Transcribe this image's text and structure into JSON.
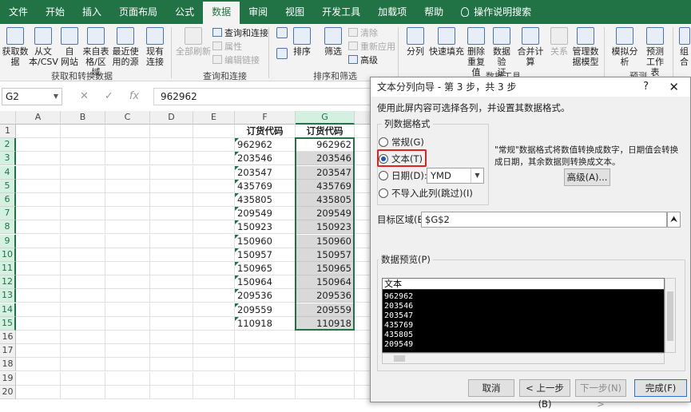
{
  "tabs": [
    "文件",
    "开始",
    "插入",
    "页面布局",
    "公式",
    "数据",
    "审阅",
    "视图",
    "开发工具",
    "加载项",
    "帮助",
    "操作说明搜索"
  ],
  "ribbon": {
    "get_data": "获取数\n据",
    "from_csv": "从文\n本/CSV",
    "from_web": "自\n网站",
    "from_table": "来自表\n格/区域",
    "recent_sources": "最近使\n用的源",
    "existing_conn": "现有\n连接",
    "group_get": "获取和转换数据",
    "refresh_all": "全部刷新",
    "queries_conn": "查询和连接",
    "properties": "属性",
    "edit_links": "编辑链接",
    "group_queries": "查询和连接",
    "sort": "排序",
    "filter": "筛选",
    "clear": "清除",
    "reapply": "重新应用",
    "advanced": "高级",
    "group_sort": "排序和筛选",
    "text_to_cols": "分列",
    "flash_fill": "快速填充",
    "remove_dup": "删除\n重复值",
    "validation": "数据验\n证",
    "consolidate": "合并计算",
    "relationships": "关系",
    "manage_model": "管理数\n据模型",
    "group_tools": "数据工具",
    "whatif": "模拟分析",
    "forecast": "预测\n工作表",
    "group_forecast": "预测",
    "outline": "组合"
  },
  "formula_bar": {
    "name_box": "G2",
    "value": "962962"
  },
  "sheet": {
    "columns": [
      "A",
      "B",
      "C",
      "D",
      "E",
      "F",
      "G"
    ],
    "rows": [
      "1",
      "2",
      "3",
      "4",
      "5",
      "6",
      "7",
      "8",
      "9",
      "10",
      "11",
      "12",
      "13",
      "14",
      "15",
      "16",
      "17",
      "18",
      "19",
      "20"
    ],
    "header_f": "订货代码",
    "header_g": "订货代码",
    "f_values": [
      "962962",
      "203546",
      "203547",
      "435769",
      "435805",
      "209549",
      "150923",
      "150960",
      "150957",
      "150965",
      "150964",
      "209536",
      "209559",
      "110918"
    ],
    "g_values": [
      "962962",
      "203546",
      "203547",
      "435769",
      "435805",
      "209549",
      "150923",
      "150960",
      "150957",
      "150965",
      "150964",
      "209536",
      "209559",
      "110918"
    ]
  },
  "dialog": {
    "title": "文本分列向导 - 第 3 步，共 3 步",
    "help": "?",
    "close": "✕",
    "instruction": "使用此屏内容可选择各列，并设置其数据格式。",
    "group_label": "列数据格式",
    "opt_general": "常规(G)",
    "opt_text": "文本(T)",
    "opt_date": "日期(D):",
    "opt_skip": "不导入此列(跳过)(I)",
    "date_format": "YMD",
    "description": "\"常规\"数据格式将数值转换成数字，日期值会转换成日期，其余数据则转换成文本。",
    "advanced_btn": "高级(A)...",
    "dest_label": "目标区域(E):",
    "dest_value": "$G$2",
    "preview_label": "数据预览(P)",
    "preview_header": "文本",
    "preview_rows": [
      "962962",
      "203546",
      "203547",
      "435769",
      "435805",
      "209549"
    ],
    "cancel": "取消",
    "back": "< 上一步(B)",
    "next": "下一步(N) >",
    "finish": "完成(F)"
  }
}
